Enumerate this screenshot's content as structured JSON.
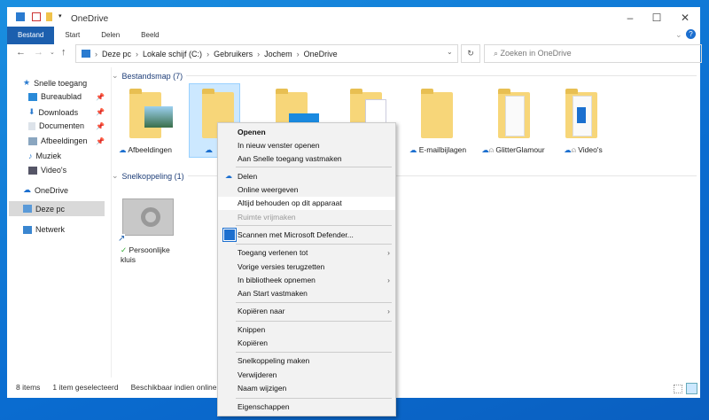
{
  "window": {
    "title": "OneDrive",
    "controls": [
      "minimize",
      "maximize",
      "close"
    ]
  },
  "ribbon": {
    "tabs": [
      "Bestand",
      "Start",
      "Delen",
      "Beeld"
    ]
  },
  "address": {
    "path": [
      "Deze pc",
      "Lokale schijf (C:)",
      "Gebruikers",
      "Jochem",
      "OneDrive"
    ],
    "search_placeholder": "Zoeken in OneDrive"
  },
  "sidebar": {
    "quick_access": "Snelle toegang",
    "items": [
      {
        "label": "Bureaublad",
        "pinned": true
      },
      {
        "label": "Downloads",
        "pinned": true
      },
      {
        "label": "Documenten",
        "pinned": true
      },
      {
        "label": "Afbeeldingen",
        "pinned": true
      },
      {
        "label": "Muziek"
      },
      {
        "label": "Video's"
      }
    ],
    "onedrive": "OneDrive",
    "this_pc": "Deze pc",
    "network": "Netwerk"
  },
  "groups": {
    "folders": "Bestandsmap (7)",
    "shortcuts": "Snelkoppeling (1)"
  },
  "folders": [
    {
      "label": "Afbeeldingen"
    },
    {
      "label": "E-mailbijlagen"
    },
    {
      "label": "GlitterGlamour"
    },
    {
      "label": "Video's"
    }
  ],
  "shortcut": {
    "label": "Persoonlijke kluis"
  },
  "context_menu": {
    "items": [
      "Openen",
      "In nieuw venster openen",
      "Aan Snelle toegang vastmaken",
      "Delen",
      "Online weergeven",
      "Altijd behouden op dit apparaat",
      "Ruimte vrijmaken",
      "Scannen met Microsoft Defender...",
      "Toegang verlenen tot",
      "Vorige versies terugzetten",
      "In bibliotheek opnemen",
      "Aan Start vastmaken",
      "Kopiëren naar",
      "Knippen",
      "Kopiëren",
      "Snelkoppeling maken",
      "Verwijderen",
      "Naam wijzigen",
      "Eigenschappen"
    ]
  },
  "status": {
    "count": "8 items",
    "selected": "1 item geselecteerd",
    "availability": "Beschikbaar indien online"
  },
  "colors": {
    "accent": "#1c5fae",
    "folder": "#f7d679",
    "selection": "#cce8ff"
  }
}
